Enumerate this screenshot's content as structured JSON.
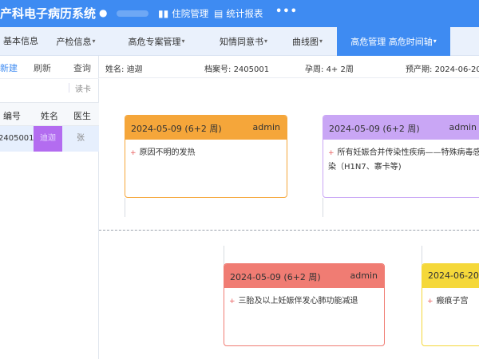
{
  "header": {
    "app_title": "产科电子病历系统",
    "menu": [
      {
        "label": "住院管理",
        "icon": "bar-chart-icon"
      },
      {
        "label": "统计报表",
        "icon": "report-icon"
      }
    ],
    "more_label": "•••"
  },
  "nav": {
    "items": [
      {
        "label": "基本信息"
      },
      {
        "label": "产检信息"
      },
      {
        "label": "高危专案管理"
      },
      {
        "label": "知情同意书"
      },
      {
        "label": "曲线图"
      },
      {
        "label": "高危管理  高危时间轴"
      }
    ],
    "active_index": 5
  },
  "left_panel": {
    "buttons": {
      "new": "新建",
      "refresh": "刷新",
      "query": "查询"
    },
    "read_card": "读卡",
    "columns": [
      "编号",
      "姓名",
      "医生"
    ],
    "rows": [
      {
        "id": "2405001",
        "name": "迪迦",
        "doctor": "张"
      }
    ]
  },
  "patient": {
    "name_label": "姓名:",
    "name": "迪迦",
    "record_label": "档案号:",
    "record_no": "2405001",
    "gest_label": "孕周:",
    "gest_week": "4+ 2周",
    "due_label": "预产期:",
    "due_date": "2024-06-20"
  },
  "timeline": {
    "colors": {
      "orange": "#f5a63a",
      "purple": "#c9a6f5",
      "red": "#f07c73",
      "yellow": "#f5d83a"
    },
    "cards": [
      {
        "date": "2024-05-09  (6+2 周)",
        "author": "admin",
        "item": "原因不明的发热",
        "item_extra": ""
      },
      {
        "date": "2024-05-09  (6+2 周)",
        "author": "admin",
        "item": "所有妊娠合并传染性疾病——特殊病毒感",
        "item_extra": "染（H1N7、寨卡等)"
      },
      {
        "date": "2024-05-09  (6+2 周)",
        "author": "admin",
        "item": "三胎及以上妊娠伴发心肺功能减退",
        "item_extra": ""
      },
      {
        "date": "2024-06-20  (",
        "author": "",
        "item": "瘢痕子宫",
        "item_extra": ""
      }
    ]
  }
}
